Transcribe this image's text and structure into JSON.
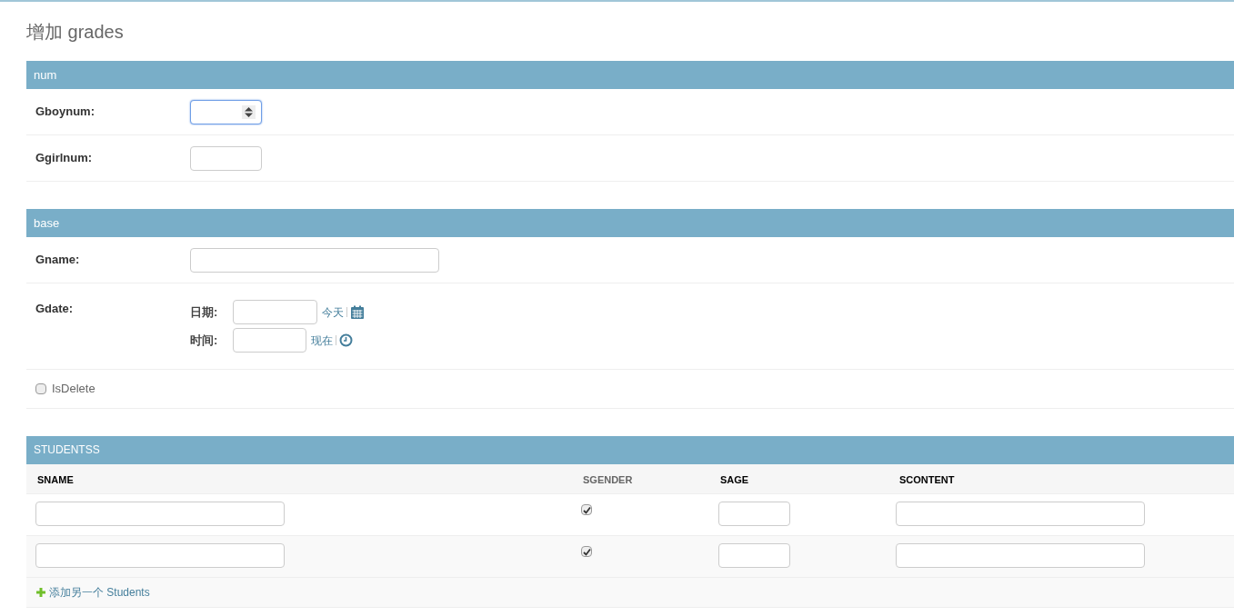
{
  "title": "增加 grades",
  "fieldsets": [
    {
      "heading": "num",
      "rows": [
        {
          "kind": "number",
          "label": "Gboynum:",
          "focused": true
        },
        {
          "kind": "number",
          "label": "Ggirlnum:",
          "focused": false
        }
      ]
    },
    {
      "heading": "base",
      "rows": [
        {
          "kind": "text",
          "label": "Gname:"
        },
        {
          "kind": "datetime",
          "label": "Gdate:",
          "date_label": "日期:",
          "date_link": "今天",
          "time_label": "时间:",
          "time_link": "现在"
        },
        {
          "kind": "checkbox",
          "label": "IsDelete",
          "checked": false
        }
      ]
    }
  ],
  "inline": {
    "heading": "STUDENTSS",
    "columns": [
      {
        "label": "SNAME",
        "required": true
      },
      {
        "label": "SGENDER",
        "required": false
      },
      {
        "label": "SAGE",
        "required": true
      },
      {
        "label": "SCONTENT",
        "required": true
      }
    ],
    "rows": [
      {
        "sgender_checked": true
      },
      {
        "sgender_checked": true
      }
    ],
    "add_link": "添加另一个 Students"
  }
}
